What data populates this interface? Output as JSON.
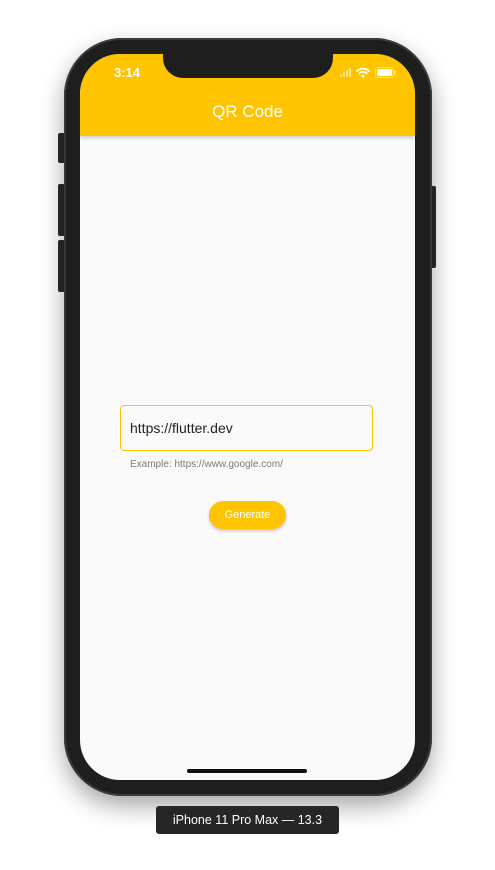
{
  "status_bar": {
    "time": "3:14",
    "icons": [
      "cellular-signal-icon",
      "wifi-icon",
      "battery-icon"
    ]
  },
  "app_bar": {
    "title": "QR Code",
    "color": "#ffc400"
  },
  "form": {
    "url_value": "https://flutter.dev",
    "helper_text": "Example: https://www.google.com/",
    "generate_label": "Generate"
  },
  "simulator": {
    "device_label": "iPhone 11 Pro Max — 13.3"
  },
  "colors": {
    "accent": "#ffc400",
    "background": "#fafafa",
    "device_frame": "#1e1e1e"
  }
}
